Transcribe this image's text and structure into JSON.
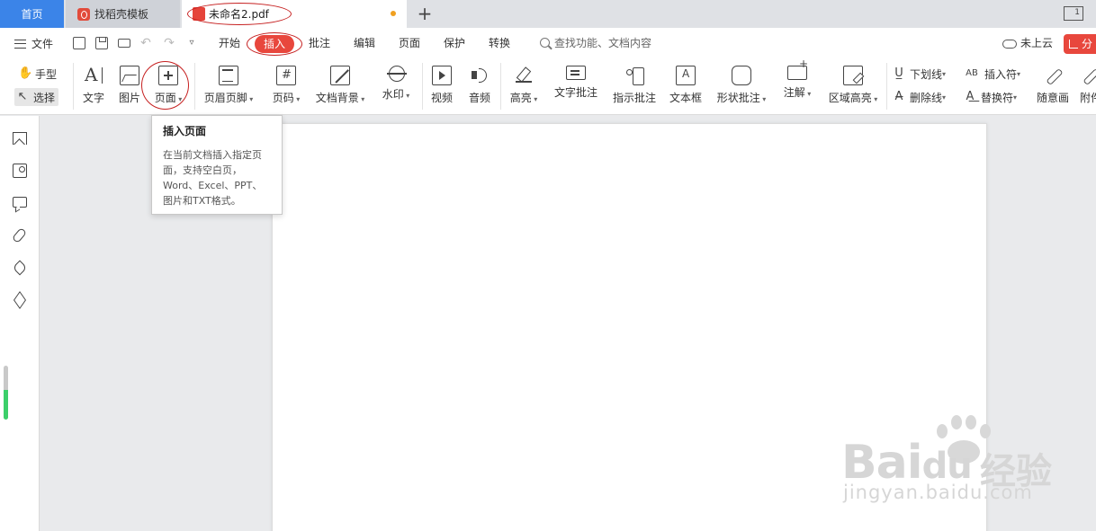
{
  "tabs": {
    "home": "首页",
    "template": "找稻壳模板",
    "document": "未命名2.pdf",
    "add": "+",
    "window_badge": "1"
  },
  "menu": {
    "file": "文件",
    "tabs": [
      "开始",
      "插入",
      "批注",
      "编辑",
      "页面",
      "保护",
      "转换"
    ],
    "active_tab": "插入",
    "search_placeholder": "查找功能、文档内容",
    "cloud": "未上云",
    "share": "分"
  },
  "ribbon": {
    "hand": "手型",
    "select": "选择",
    "text": "文字",
    "image": "图片",
    "page": "页面",
    "header_footer": "页眉页脚",
    "page_number": "页码",
    "doc_background": "文档背景",
    "watermark": "水印",
    "video": "视频",
    "audio": "音频",
    "highlight": "高亮",
    "text_comment": "文字批注",
    "pointer_comment": "指示批注",
    "text_box": "文本框",
    "shape_comment": "形状批注",
    "note": "注解",
    "area_highlight": "区域高亮",
    "underline": "下划线",
    "strikethrough": "删除线",
    "insert_symbol": "插入符",
    "replace_symbol": "替换符",
    "freehand": "随意画",
    "attachment": "附件"
  },
  "tooltip": {
    "title": "插入页面",
    "body": "在当前文档插入指定页面，支持空白页，Word、Excel、PPT、图片和TXT格式。"
  },
  "watermark": {
    "brand": "Bai",
    "brand2": "du",
    "brand_cn": "经验",
    "url": "jingyan.baidu.com"
  },
  "colors": {
    "accent_blue": "#3b84e8",
    "accent_red": "#e8473d",
    "annotation_red": "#c62020"
  }
}
